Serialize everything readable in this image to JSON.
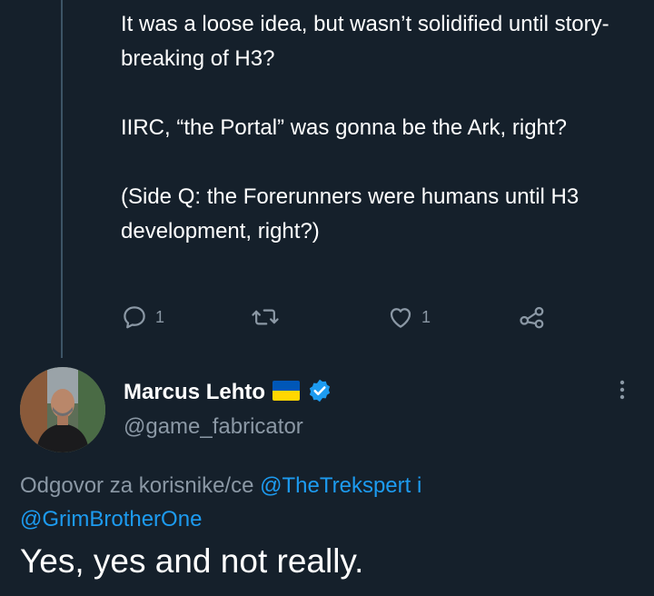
{
  "previous_tweet": {
    "paragraphs": [
      "It was a loose idea, but wasn’t solidified until story-breaking of H3?",
      "IIRC, “the Portal” was gonna be the Ark, right?",
      "(Side Q: the Forerunners were humans until H3 development, right?)"
    ],
    "actions": {
      "reply_count": "1",
      "retweet_count": "",
      "like_count": "1"
    }
  },
  "icons": {
    "reply": "reply-icon",
    "retweet": "retweet-icon",
    "like": "heart-icon",
    "share": "share-icon",
    "flag": "ukraine-flag-icon",
    "verified": "verified-badge-icon",
    "more": "more-vertical-icon"
  },
  "colors": {
    "background": "#15202b",
    "secondary_text": "#8b98a5",
    "accent": "#1d9bf0",
    "flag_blue": "#0057b7",
    "flag_yellow": "#ffd700"
  },
  "tweet": {
    "display_name": "Marcus Lehto",
    "handle": "@game_fabricator",
    "reply_prefix": "Odgovor za korisnike/ce",
    "mention_1": "@TheTrekspert",
    "conjunction": "i",
    "mention_2": "@GrimBrotherOne",
    "text": "Yes, yes and not really."
  }
}
